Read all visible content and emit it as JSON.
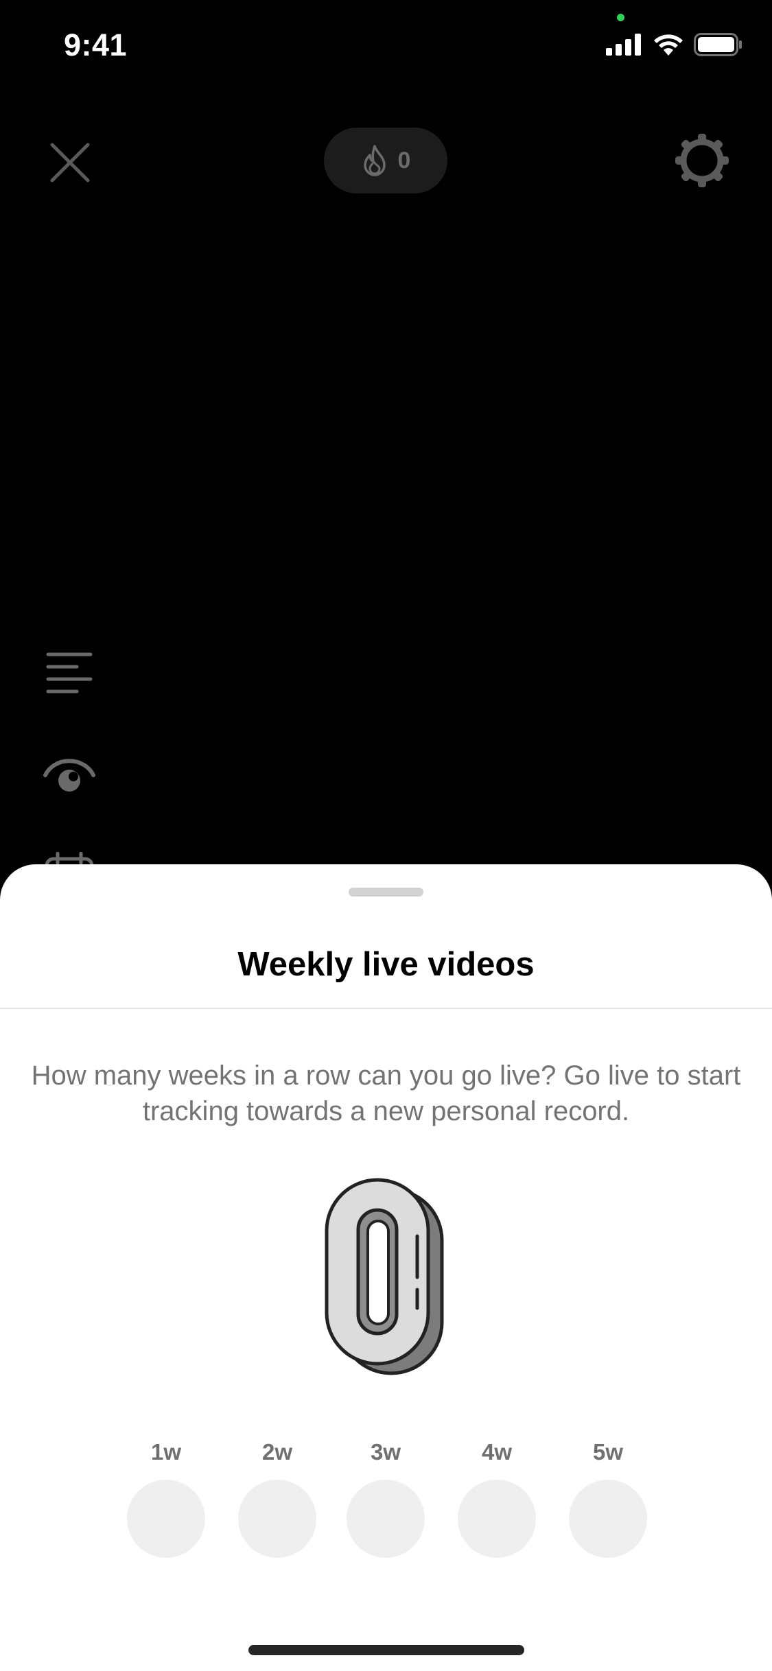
{
  "status_bar": {
    "time": "9:41",
    "signal_icon": "cellular-signal-icon",
    "wifi_icon": "wifi-icon",
    "battery_icon": "battery-icon",
    "privacy_indicator_color": "#2fd158"
  },
  "top_bar": {
    "close_icon": "close-icon",
    "flame_count": "0",
    "flame_icon": "flame-icon",
    "settings_icon": "gear-icon"
  },
  "side_tools": [
    {
      "icon": "text-lines-icon"
    },
    {
      "icon": "eye-icon"
    },
    {
      "icon": "calendar-icon"
    }
  ],
  "sheet": {
    "title": "Weekly live videos",
    "description": "How many weeks in a row can you go live? Go live to start tracking towards a new personal record.",
    "illustration": "zero-badge-icon",
    "weeks": [
      {
        "label": "1w",
        "completed": false
      },
      {
        "label": "2w",
        "completed": false
      },
      {
        "label": "3w",
        "completed": false
      },
      {
        "label": "4w",
        "completed": false
      },
      {
        "label": "5w",
        "completed": false
      }
    ]
  },
  "colors": {
    "background": "#000000",
    "sheet_background": "#ffffff",
    "week_circle": "#efefef",
    "muted_text": "#737373"
  }
}
